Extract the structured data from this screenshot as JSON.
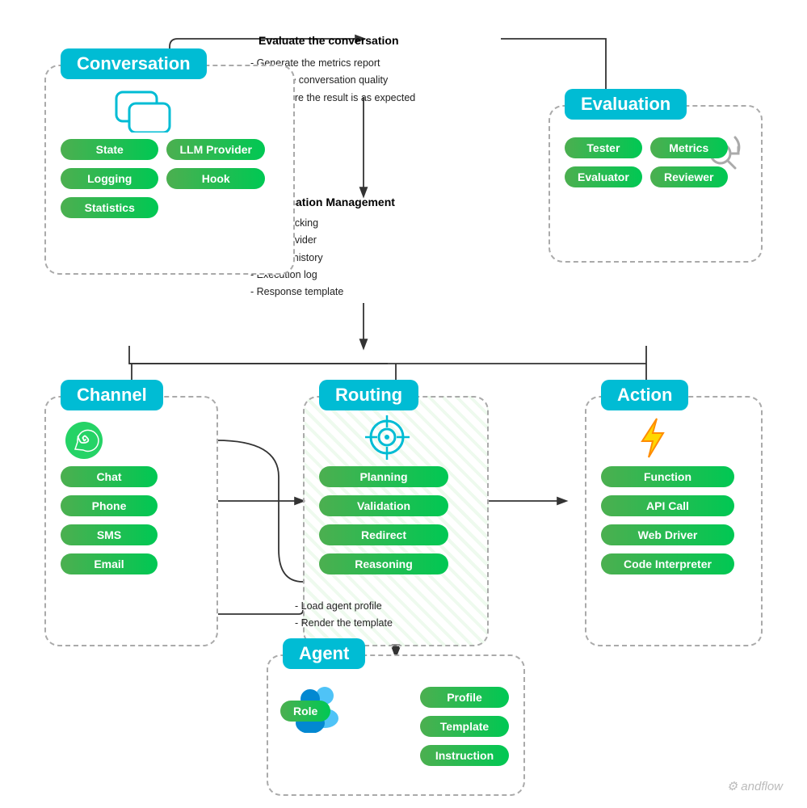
{
  "conversation": {
    "header": "Conversation",
    "pills": [
      "State",
      "LLM Provider",
      "Logging",
      "Hook",
      "Statistics"
    ]
  },
  "evaluation": {
    "header": "Evaluation",
    "pills": [
      "Tester",
      "Metrics",
      "Evaluator",
      "Reviewer"
    ]
  },
  "evaluate_section": {
    "title": "Evaluate the conversation",
    "items": [
      "- Generate the metrics report",
      "- Audit the conversation quality",
      "- Make sure the result is as expected"
    ]
  },
  "conv_mgmt": {
    "title": "Conversation Management",
    "items": [
      "- State tracking",
      "- LLM Provider",
      "- Dialogs history",
      "- Execution log",
      "- Response template"
    ]
  },
  "channel": {
    "header": "Channel",
    "pills": [
      "Chat",
      "Phone",
      "SMS",
      "Email"
    ]
  },
  "routing": {
    "header": "Routing",
    "pills": [
      "Planning",
      "Validation",
      "Redirect",
      "Reasoning"
    ]
  },
  "action": {
    "header": "Action",
    "pills": [
      "Function",
      "API Call",
      "Web Driver",
      "Code Interpreter"
    ]
  },
  "agent": {
    "header": "Agent",
    "pills_left": [
      "Role"
    ],
    "pills_right": [
      "Profile",
      "Template",
      "Instruction"
    ]
  },
  "agent_load": {
    "items": [
      "- Load agent profile",
      "- Render the template"
    ]
  },
  "watermark": "⚙ andflow"
}
